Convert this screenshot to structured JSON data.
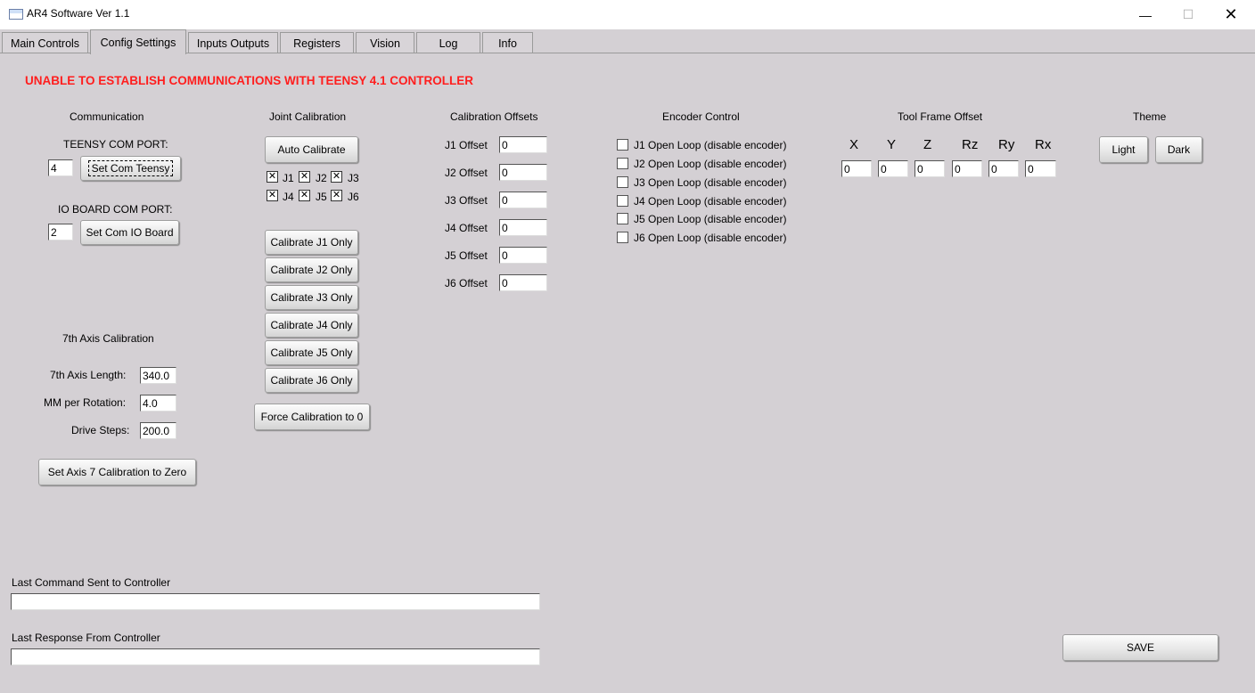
{
  "window": {
    "title": "AR4 Software Ver 1.1",
    "min": "—",
    "max": "☐",
    "close": "✕"
  },
  "tabs": [
    "Main Controls",
    "Config Settings",
    "Inputs Outputs",
    "Registers",
    "Vision",
    "Log",
    "Info"
  ],
  "active_tab": "Config Settings",
  "error": "UNABLE TO ESTABLISH COMMUNICATIONS WITH TEENSY 4.1 CONTROLLER",
  "communication": {
    "header": "Communication",
    "teensy_label": "TEENSY COM PORT:",
    "teensy_value": "4",
    "teensy_button": "Set Com Teensy",
    "io_label": "IO BOARD COM PORT:",
    "io_value": "2",
    "io_button": "Set Com IO Board"
  },
  "axis7": {
    "header": "7th Axis Calibration",
    "length_label": "7th Axis Length:",
    "length_value": "340.0",
    "mm_label": "MM per Rotation:",
    "mm_value": "4.0",
    "steps_label": "Drive Steps:",
    "steps_value": "200.0",
    "zero_button": "Set Axis 7 Calibration to Zero"
  },
  "joint_cal": {
    "header": "Joint Calibration",
    "auto_button": "Auto Calibrate",
    "checks": [
      {
        "label": "J1",
        "checked": true
      },
      {
        "label": "J2",
        "checked": true
      },
      {
        "label": "J3",
        "checked": true
      },
      {
        "label": "J4",
        "checked": true
      },
      {
        "label": "J5",
        "checked": true
      },
      {
        "label": "J6",
        "checked": true
      }
    ],
    "buttons": [
      "Calibrate J1 Only",
      "Calibrate J2 Only",
      "Calibrate J3 Only",
      "Calibrate J4 Only",
      "Calibrate J5 Only",
      "Calibrate J6 Only"
    ],
    "force_button": "Force Calibration to 0"
  },
  "offsets": {
    "header": "Calibration Offsets",
    "rows": [
      {
        "label": "J1 Offset",
        "value": "0"
      },
      {
        "label": "J2 Offset",
        "value": "0"
      },
      {
        "label": "J3 Offset",
        "value": "0"
      },
      {
        "label": "J4 Offset",
        "value": "0"
      },
      {
        "label": "J5 Offset",
        "value": "0"
      },
      {
        "label": "J6 Offset",
        "value": "0"
      }
    ]
  },
  "encoder": {
    "header": "Encoder Control",
    "items": [
      {
        "label": "J1 Open Loop (disable encoder)",
        "checked": false
      },
      {
        "label": "J2 Open Loop (disable encoder)",
        "checked": false
      },
      {
        "label": "J3 Open Loop (disable encoder)",
        "checked": false
      },
      {
        "label": "J4 Open Loop (disable encoder)",
        "checked": false
      },
      {
        "label": "J5 Open Loop (disable encoder)",
        "checked": false
      },
      {
        "label": "J6 Open Loop (disable encoder)",
        "checked": false
      }
    ]
  },
  "tool_frame": {
    "header": "Tool Frame Offset",
    "axes": [
      {
        "label": "X",
        "value": "0"
      },
      {
        "label": "Y",
        "value": "0"
      },
      {
        "label": "Z",
        "value": "0"
      },
      {
        "label": "Rz",
        "value": "0"
      },
      {
        "label": "Ry",
        "value": "0"
      },
      {
        "label": "Rx",
        "value": "0"
      }
    ]
  },
  "theme": {
    "header": "Theme",
    "light": "Light",
    "dark": "Dark"
  },
  "last_command": {
    "label": "Last Command Sent to Controller",
    "value": ""
  },
  "last_response": {
    "label": "Last Response From Controller",
    "value": ""
  },
  "save_button": "SAVE"
}
